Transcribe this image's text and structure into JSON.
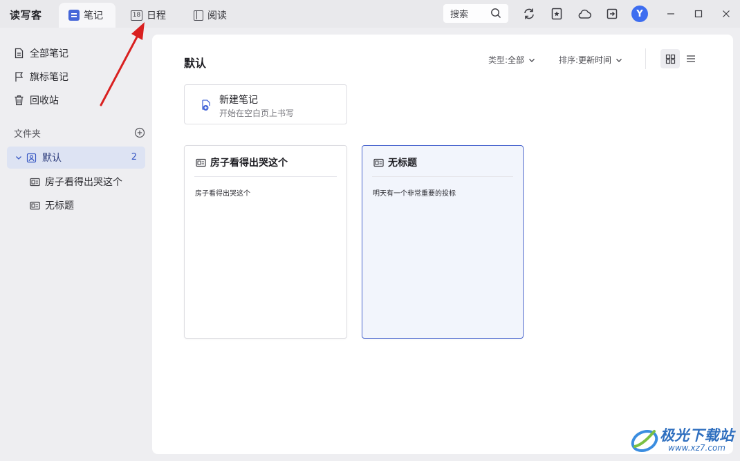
{
  "app": {
    "name": "读写客"
  },
  "tabs": [
    {
      "label": "笔记",
      "active": true,
      "icon": "note-icon"
    },
    {
      "label": "日程",
      "active": false,
      "icon": "calendar-icon",
      "icon_text": "18"
    },
    {
      "label": "阅读",
      "active": false,
      "icon": "book-icon"
    }
  ],
  "toolbar": {
    "search_label": "搜索",
    "icons": [
      "sync-icon",
      "star-note-icon",
      "cloud-icon",
      "export-icon"
    ],
    "avatar_letter": "Y",
    "window_controls": [
      "minimize-icon",
      "maximize-icon",
      "close-icon"
    ]
  },
  "sidebar": {
    "items": [
      {
        "label": "全部笔记",
        "icon": "document-icon"
      },
      {
        "label": "旗标笔记",
        "icon": "flag-icon"
      },
      {
        "label": "回收站",
        "icon": "trash-icon"
      }
    ],
    "folders_label": "文件夹",
    "folder": {
      "label": "默认",
      "count": "2",
      "expanded": true
    },
    "notes": [
      {
        "label": "房子看得出哭这个",
        "icon": "note-card-icon"
      },
      {
        "label": "无标题",
        "icon": "note-card-icon"
      }
    ]
  },
  "main": {
    "title": "默认",
    "filter_type": {
      "label": "类型:",
      "value": "全部"
    },
    "filter_sort": {
      "label": "排序:",
      "value": "更新时间"
    },
    "view_modes": [
      "grid-view-icon",
      "list-view-icon"
    ],
    "active_view": "grid",
    "new_note": {
      "title": "新建笔记",
      "subtitle": "开始在空白页上书写"
    },
    "cards": [
      {
        "title": "房子看得出哭这个",
        "body": "房子看得出哭这个",
        "selected": false
      },
      {
        "title": "无标题",
        "body": "明天有一个非常重要的投标",
        "selected": true
      }
    ]
  },
  "watermark": {
    "text": "极光下载站",
    "url": "www.xz7.com"
  },
  "colors": {
    "accent": "#4566d8",
    "selected_bg": "#f2f5fc",
    "annotation_arrow": "#d92020"
  }
}
